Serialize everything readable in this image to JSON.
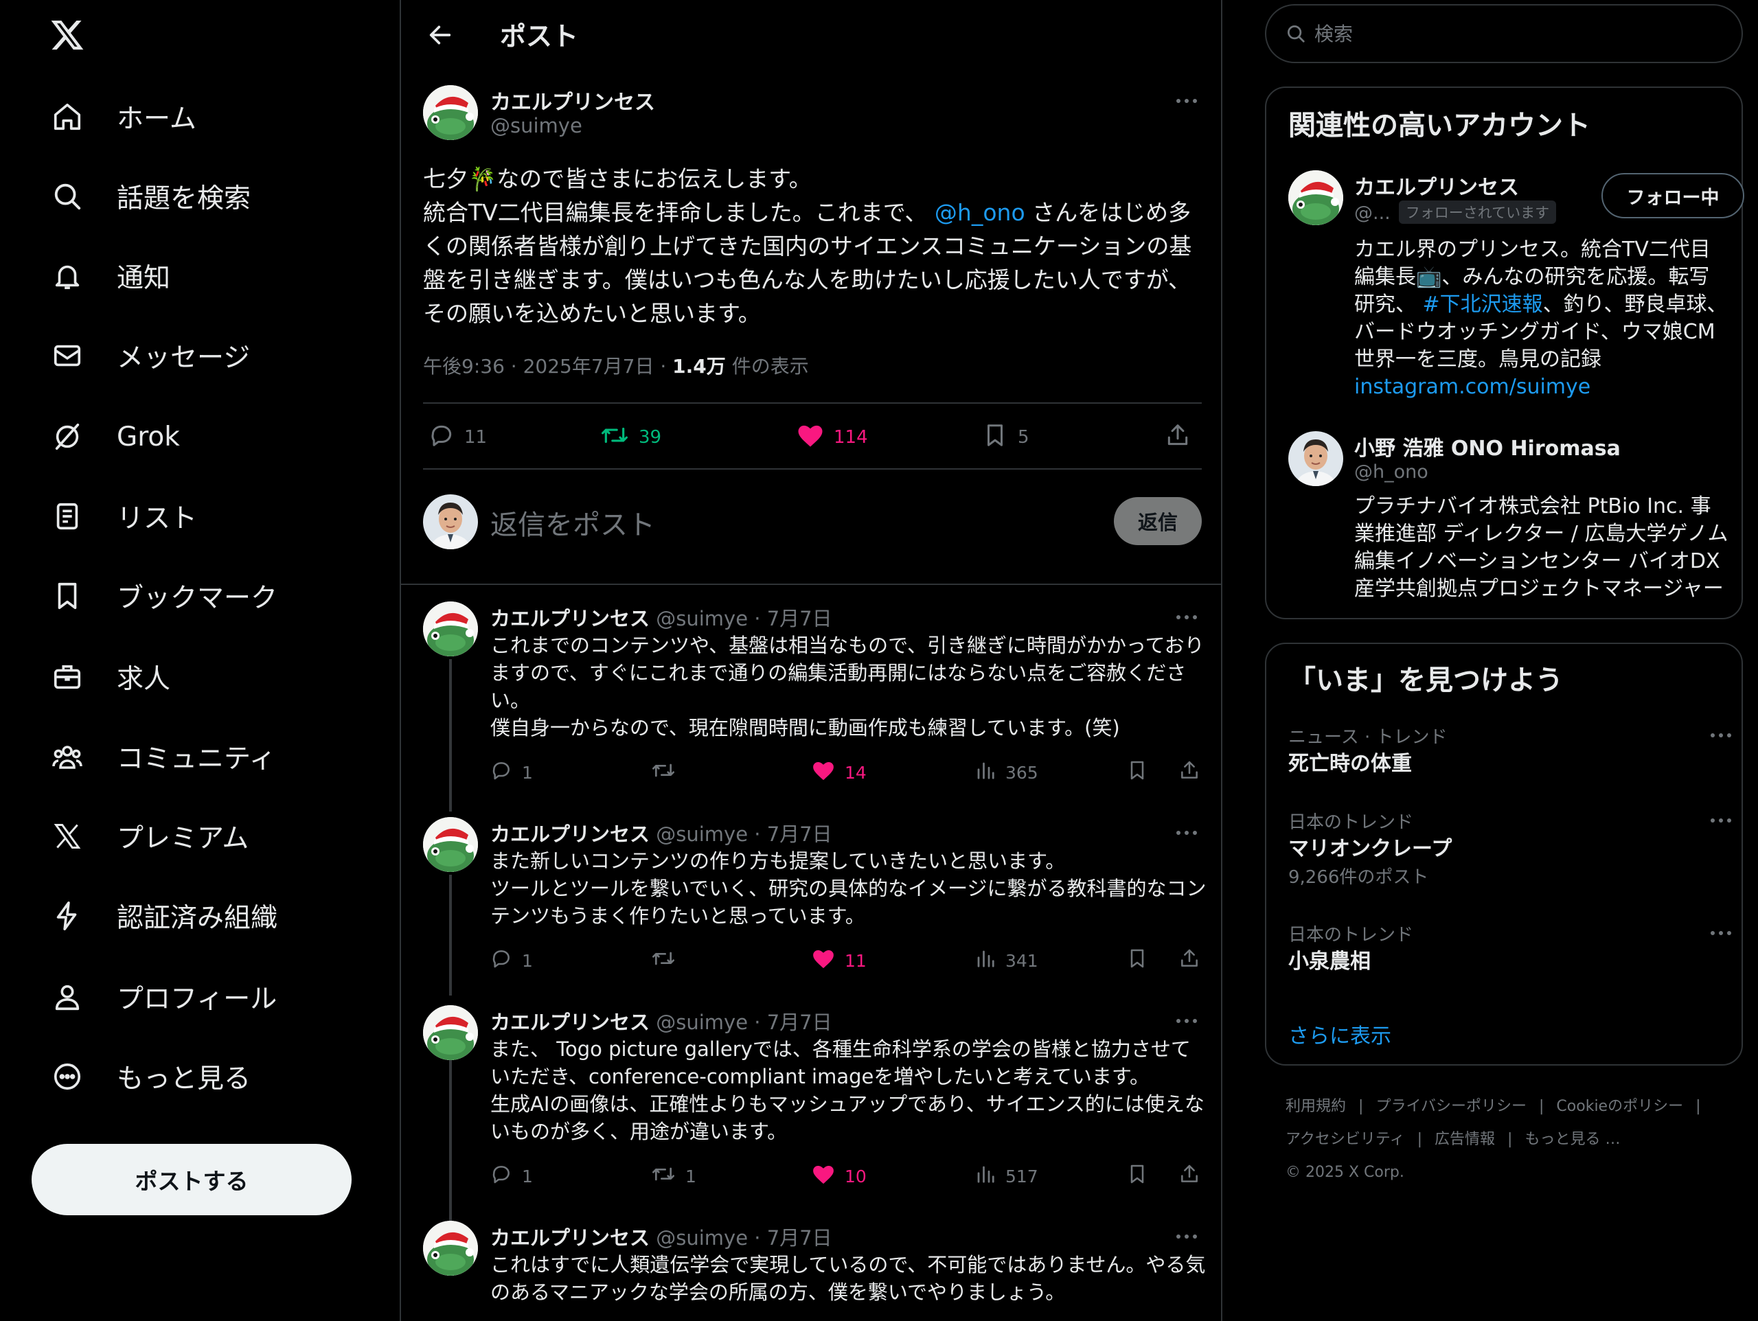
{
  "nav": {
    "items": [
      {
        "label": "ホーム",
        "icon": "home-icon"
      },
      {
        "label": "話題を検索",
        "icon": "search-icon"
      },
      {
        "label": "通知",
        "icon": "bell-icon"
      },
      {
        "label": "メッセージ",
        "icon": "mail-icon"
      },
      {
        "label": "Grok",
        "icon": "grok-icon"
      },
      {
        "label": "リスト",
        "icon": "list-icon"
      },
      {
        "label": "ブックマーク",
        "icon": "bookmark-icon"
      },
      {
        "label": "求人",
        "icon": "briefcase-icon"
      },
      {
        "label": "コミュニティ",
        "icon": "people-icon"
      },
      {
        "label": "プレミアム",
        "icon": "x-logo-icon"
      },
      {
        "label": "認証済み組織",
        "icon": "lightning-icon"
      },
      {
        "label": "プロフィール",
        "icon": "person-icon"
      },
      {
        "label": "もっと見る",
        "icon": "more-circle-icon"
      }
    ],
    "post_button": "ポストする"
  },
  "header": {
    "title": "ポスト"
  },
  "focal_post": {
    "author_name": "カエルプリンセス",
    "author_handle": "@suimye",
    "line1": "七夕🎋なので皆さまにお伝えします。",
    "line2_a": "統合TV二代目編集長を拝命しました。これまで、",
    "mention": "@h_ono",
    "line2_b": "さんをはじめ多くの関係者皆様が創り上げてきた国内のサイエンスコミュニケーションの基盤を引き継ぎます。僕はいつも色んな人を助けたいし応援したい人ですが、その願いを込めたいと思います。",
    "time": "午後9:36 · 2025年7月7日 · ",
    "views": "1.4万",
    "views_label": "件の表示",
    "replies": "11",
    "reposts": "39",
    "likes": "114",
    "bookmarks": "5"
  },
  "composer": {
    "placeholder": "返信をポスト",
    "reply_button": "返信"
  },
  "replies": [
    {
      "name": "カエルプリンセス",
      "handle": "@suimye",
      "sep": " · ",
      "date": "7月7日",
      "lines": [
        "これまでのコンテンツや、基盤は相当なもので、引き継ぎに時間がかかっておりますので、すぐにこれまで通りの編集活動再開にはならない点をご容赦ください。",
        "僕自身一からなので、現在隙間時間に動画作成も練習しています。(笑)"
      ],
      "replies": "1",
      "reposts": "",
      "likes": "14",
      "views": "365"
    },
    {
      "name": "カエルプリンセス",
      "handle": "@suimye",
      "sep": " · ",
      "date": "7月7日",
      "lines": [
        "また新しいコンテンツの作り方も提案していきたいと思います。",
        "ツールとツールを繋いでいく、研究の具体的なイメージに繋がる教科書的なコンテンツもうまく作りたいと思っています。"
      ],
      "replies": "1",
      "reposts": "",
      "likes": "11",
      "views": "341"
    },
    {
      "name": "カエルプリンセス",
      "handle": "@suimye",
      "sep": " · ",
      "date": "7月7日",
      "lines": [
        "また、 Togo picture galleryでは、各種生命科学系の学会の皆様と協力させていただき、conference-compliant imageを増やしたいと考えています。",
        "生成AIの画像は、正確性よりもマッシュアップであり、サイエンス的には使えないものが多く、用途が違います。"
      ],
      "replies": "1",
      "reposts": "1",
      "likes": "10",
      "views": "517"
    },
    {
      "name": "カエルプリンセス",
      "handle": "@suimye",
      "sep": " · ",
      "date": "7月7日",
      "lines": [
        "これはすでに人類遺伝学会で実現しているので、不可能ではありません。やる気のあるマニアックな学会の所属の方、僕を繋いでやりましょう。"
      ],
      "replies": "",
      "reposts": "",
      "likes": "",
      "views": ""
    }
  ],
  "search": {
    "placeholder": "検索"
  },
  "related": {
    "title": "関連性の高いアカウント",
    "accounts": [
      {
        "name": "カエルプリンセス",
        "handle": "@...",
        "follows_you": "フォローされています",
        "button": "フォロー中",
        "bio_1": "カエル界のプリンセス。統合TV二代目編集長📺、みんなの研究を応援。転写研究、",
        "hashtag": "#下北沢速報",
        "bio_2": "、釣り、野良卓球、バードウオッチングガイド、ウマ娘CM世界一を三度。鳥見の記録",
        "link": "instagram.com/suimye"
      },
      {
        "name": "小野 浩雅 ONO Hiromasa",
        "handle": "@h_ono",
        "bio": "プラチナバイオ株式会社 PtBio Inc. 事業推進部 ディレクター / 広島大学ゲノム編集イノベーションセンター バイオDX産学共創拠点プロジェクトマネージャー"
      }
    ]
  },
  "trends": {
    "title": "「いま」を見つけよう",
    "items": [
      {
        "meta": "ニュース · トレンド",
        "name": "死亡時の体重",
        "count": ""
      },
      {
        "meta": "日本のトレンド",
        "name": "マリオンクレープ",
        "count": "9,266件のポスト"
      },
      {
        "meta": "日本のトレンド",
        "name": "小泉農相",
        "count": ""
      }
    ],
    "show_more": "さらに表示"
  },
  "footer": {
    "links": [
      "利用規約",
      "|",
      "プライバシーポリシー",
      "|",
      "Cookieのポリシー",
      "|",
      "アクセシビリティ",
      "|",
      "広告情報",
      "|",
      "もっと見る …"
    ],
    "copyright": "© 2025 X Corp."
  },
  "colors": {
    "background": "#000000",
    "text": "#e7e9ea",
    "muted": "#71767b",
    "accent": "#1d9bf0",
    "like": "#f91880",
    "repost": "#00ba7c",
    "border": "#2f3336"
  }
}
